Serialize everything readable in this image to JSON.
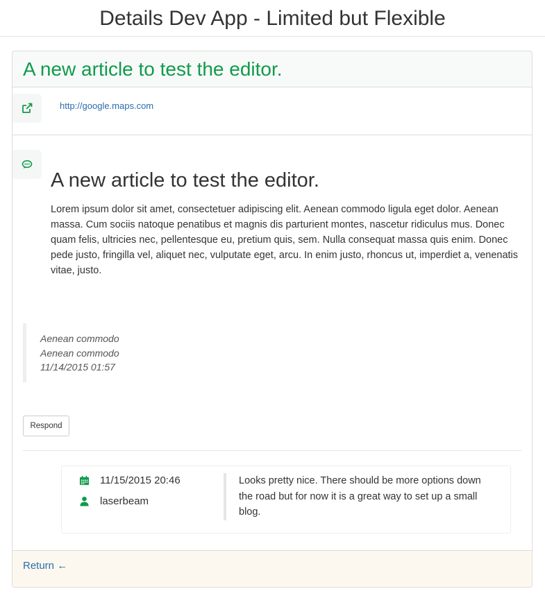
{
  "header": {
    "title": "Details Dev App - Limited but Flexible"
  },
  "panel": {
    "title": "A new article to test the editor.",
    "link": {
      "url": "http://google.maps.com",
      "icon": "external-link-icon"
    },
    "article": {
      "icon": "comment-icon",
      "heading": "A new article to test the editor.",
      "body": "Lorem ipsum dolor sit amet, consectetuer adipiscing elit. Aenean commodo ligula eget dolor. Aenean massa. Cum sociis natoque penatibus et magnis dis parturient montes, nascetur ridiculus mus. Donec quam felis, ultricies nec, pellentesque eu, pretium quis, sem. Nulla consequat massa quis enim. Donec pede justo, fringilla vel, aliquet nec, vulputate eget, arcu. In enim justo, rhoncus ut, imperdiet a, venenatis vitae, justo."
    },
    "quote": {
      "line1": "Aenean commodo",
      "line2": "Aenean commodo",
      "timestamp": "11/14/2015 01:57"
    },
    "respond_label": "Respond",
    "comment": {
      "date": "11/15/2015 20:46",
      "date_icon": "calendar-icon",
      "user": "laserbeam",
      "user_icon": "user-icon",
      "text": "Looks pretty nice. There should be more options down the road but for now it is a great way to set up a small blog."
    },
    "footer": {
      "return_label": "Return ←"
    }
  },
  "colors": {
    "accent_green": "#119a4c",
    "link_blue": "#2a6db0",
    "footer_bg": "#fdf8ef"
  }
}
